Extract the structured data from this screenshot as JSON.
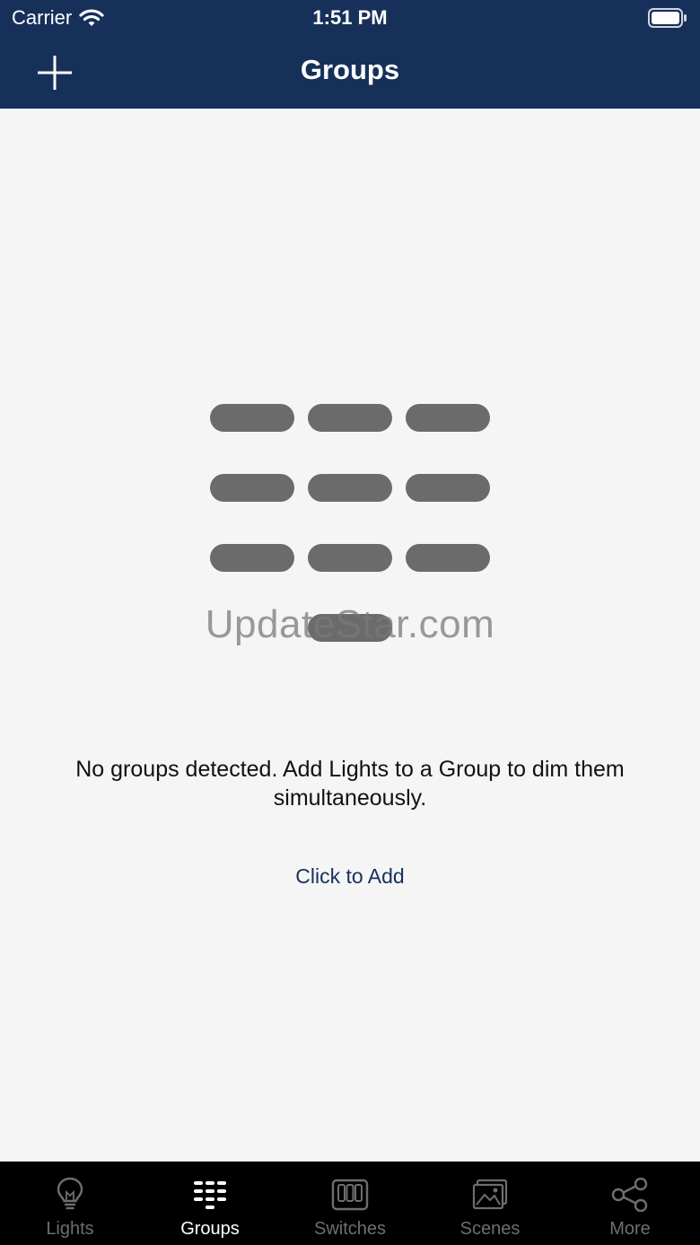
{
  "status_bar": {
    "carrier": "Carrier",
    "time": "1:51 PM"
  },
  "nav": {
    "title": "Groups"
  },
  "empty_state": {
    "message": "No groups detected. Add Lights to a Group to dim them simultaneously.",
    "add_link": "Click to Add"
  },
  "watermark": "UpdateStar.com",
  "tabs": [
    {
      "label": "Lights",
      "icon": "lightbulb-icon",
      "active": false
    },
    {
      "label": "Groups",
      "icon": "groups-icon",
      "active": true
    },
    {
      "label": "Switches",
      "icon": "switches-icon",
      "active": false
    },
    {
      "label": "Scenes",
      "icon": "scenes-icon",
      "active": false
    },
    {
      "label": "More",
      "icon": "share-icon",
      "active": false
    }
  ],
  "colors": {
    "header_bg": "#17305a",
    "accent": "#17305a",
    "tab_active": "#ffffff",
    "tab_inactive": "#6e6e6e"
  }
}
